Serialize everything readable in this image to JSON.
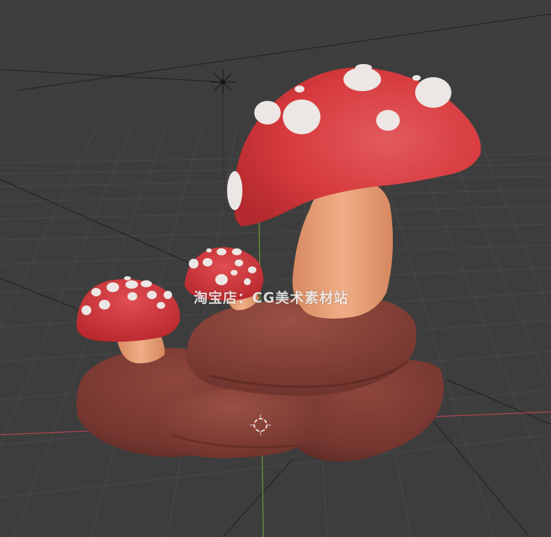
{
  "watermark": {
    "text": "淘宝店：CG美术素材站"
  },
  "viewport": {
    "background_color": "#3d3d3d",
    "grid_color": "#4a4a4a",
    "x_axis_color": "#b0454f",
    "y_axis_color": "#6f9a36"
  },
  "scene": {
    "objects": [
      "mushroom-large",
      "mushroom-medium",
      "mushroom-small",
      "rock-base"
    ],
    "colors": {
      "cap_red": "#d83a3e",
      "cap_spots": "#ece6e4",
      "stem": "#e9a57d",
      "rock": "#7a3a33"
    }
  },
  "gizmos": [
    "light-gizmo",
    "3d-cursor"
  ]
}
